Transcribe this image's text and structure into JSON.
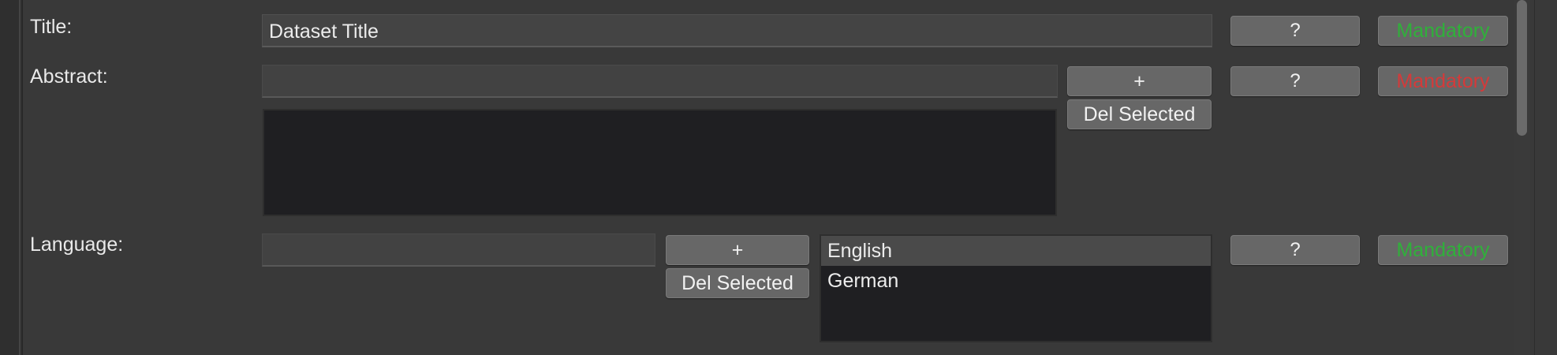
{
  "colors": {
    "mandatory_ok": "#2fb13a",
    "mandatory_missing": "#d43a3a"
  },
  "rows": {
    "title": {
      "label": "Title:",
      "value": "Dataset Title",
      "help_label": "?",
      "mandatory_label": "Mandatory",
      "mandatory_state": "ok"
    },
    "abstract": {
      "label": "Abstract:",
      "value": "",
      "add_label": "+",
      "del_label": "Del Selected",
      "help_label": "?",
      "mandatory_label": "Mandatory",
      "mandatory_state": "missing"
    },
    "language": {
      "label": "Language:",
      "value": "",
      "add_label": "+",
      "del_label": "Del Selected",
      "items": [
        "English",
        "German"
      ],
      "selected_item": "English",
      "help_label": "?",
      "mandatory_label": "Mandatory",
      "mandatory_state": "ok"
    }
  }
}
